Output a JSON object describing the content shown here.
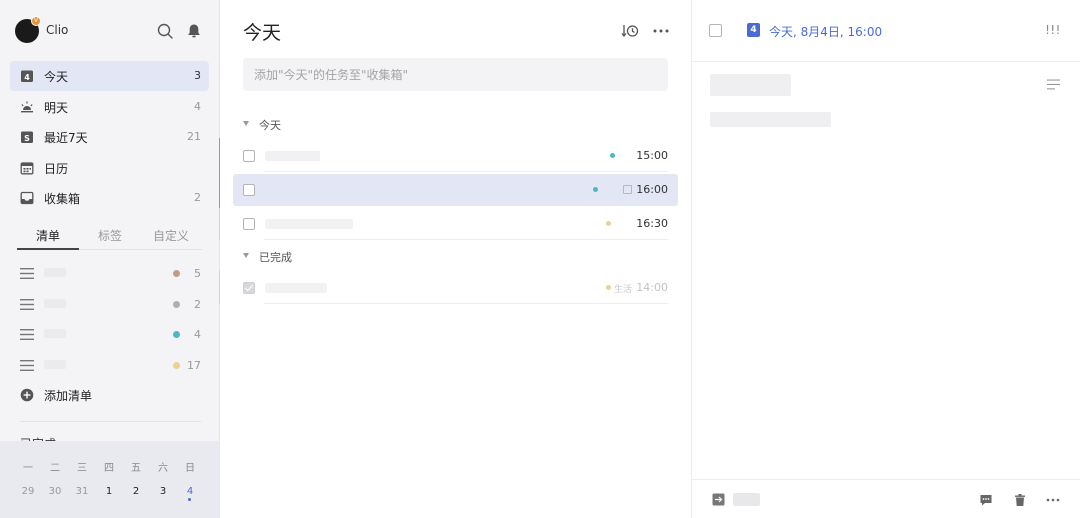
{
  "user": {
    "name": "Clio",
    "badge": "V"
  },
  "icons": {
    "search": "search-icon",
    "notifications": "bell-icon",
    "today": "calendar-today-icon",
    "tomorrow": "sunrise-icon",
    "next7": "calendar-week-icon",
    "calendar": "calendar-icon",
    "inbox": "inbox-icon",
    "list": "hamburger-list-icon",
    "add": "plus-circle-icon",
    "sort": "sort-clock-icon",
    "more": "more-horizontal-icon",
    "comment": "comment-icon",
    "trash": "trash-icon",
    "move": "move-to-list-icon",
    "description": "text-lines-icon"
  },
  "colors": {
    "accent": "#4a6bd6",
    "selected_bg": "#e3e6f5",
    "sidebar_bg": "#f4f4f6",
    "teal": "#4bb8c4",
    "yellow": "#e8d391",
    "brown": "#c39a8a",
    "gray": "#b0aeb4"
  },
  "nav": [
    {
      "label": "今天",
      "count": "3",
      "icon": "calendar-today-icon",
      "active": true
    },
    {
      "label": "明天",
      "count": "4",
      "icon": "sunrise-icon"
    },
    {
      "label": "最近7天",
      "count": "21",
      "icon": "calendar-week-icon"
    },
    {
      "label": "日历",
      "count": "",
      "icon": "calendar-icon"
    },
    {
      "label": "收集箱",
      "count": "2",
      "icon": "inbox-icon"
    }
  ],
  "tabs": [
    "清单",
    "标签",
    "自定义"
  ],
  "lists": [
    {
      "count": "5",
      "dot": "#c39a8a"
    },
    {
      "count": "2",
      "dot": "#b0aeb4"
    },
    {
      "count": "4",
      "dot": "#4bb8c4"
    },
    {
      "count": "17",
      "dot": "#e8d391"
    }
  ],
  "add_list_label": "添加清单",
  "completed_peek": "已完成",
  "mini_calendar": {
    "weekdays": [
      "一",
      "二",
      "三",
      "四",
      "五",
      "六",
      "日"
    ],
    "dates": [
      "29",
      "30",
      "31",
      "1",
      "2",
      "3",
      "4"
    ]
  },
  "main": {
    "title": "今天",
    "add_placeholder": "添加\"今天\"的任务至\"收集箱\"",
    "sections": {
      "today": "今天",
      "completed": "已完成"
    },
    "tasks": [
      {
        "time": "15:00",
        "dot": "#4bb8c4"
      },
      {
        "time": "16:00",
        "dot": "#4bb8c4",
        "selected": true
      },
      {
        "time": "16:30",
        "dot": "#e8d391"
      }
    ],
    "completed_tasks": [
      {
        "time": "14:00",
        "tag": "生活",
        "dot": "#e8d391"
      }
    ]
  },
  "detail": {
    "date_icon_num": "4",
    "date_text": "今天, 8月4日, 16:00",
    "priority": "!!!"
  }
}
